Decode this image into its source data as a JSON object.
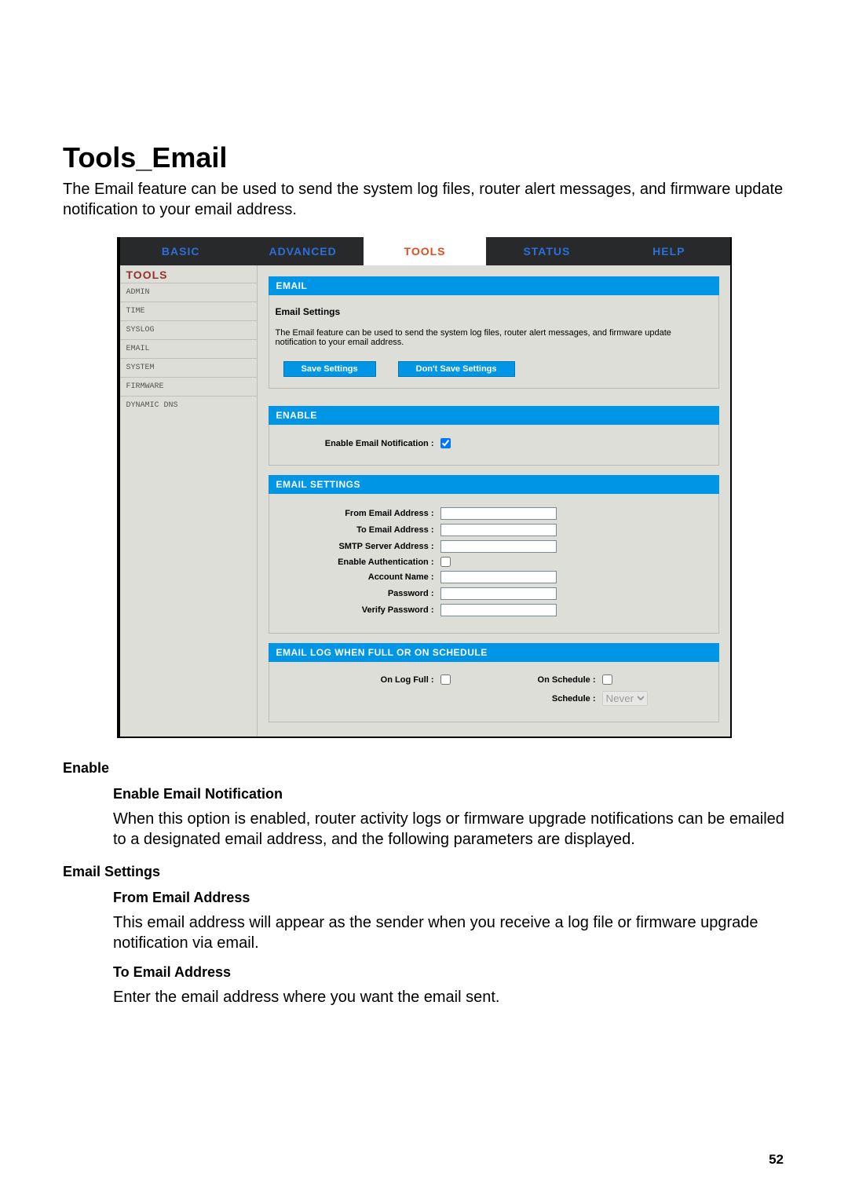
{
  "doc": {
    "title": "Tools_Email",
    "intro": "The Email feature can be used to send the system log files, router alert messages, and firmware update notification to your email address.",
    "page_number": "52",
    "sections": {
      "enable_h": "Enable",
      "enable_sub": "Enable Email Notification",
      "enable_p": "When this option is enabled, router activity logs or firmware upgrade notifications can be emailed to a designated email address, and the following parameters are displayed.",
      "emailset_h": "Email Settings",
      "from_sub": "From Email Address",
      "from_p": "This email address will appear as the sender when you receive a log file or firmware upgrade notification via email.",
      "to_sub": "To Email Address",
      "to_p": "Enter the email address where you want the email sent."
    }
  },
  "ui": {
    "tabs": [
      "BASIC",
      "ADVANCED",
      "TOOLS",
      "STATUS",
      "HELP"
    ],
    "active_tab": "TOOLS",
    "sidebar_header": "TOOLS",
    "sidebar": [
      "ADMIN",
      "TIME",
      "SYSLOG",
      "EMAIL",
      "SYSTEM",
      "FIRMWARE",
      "DYNAMIC DNS"
    ],
    "panel1_title": "EMAIL",
    "panel1_sub": "Email Settings",
    "panel1_desc": "The Email feature can be used to send the system log files, router alert messages, and firmware update notification to your email address.",
    "btn_save": "Save Settings",
    "btn_dont": "Don't Save Settings",
    "panel_enable": "ENABLE",
    "enable_label": "Enable Email Notification :",
    "enable_checked": true,
    "panel_settings": "EMAIL SETTINGS",
    "from_label": "From Email Address :",
    "to_label": "To Email Address :",
    "smtp_label": "SMTP Server Address :",
    "auth_label": "Enable Authentication :",
    "auth_checked": false,
    "acct_label": "Account Name :",
    "pwd_label": "Password :",
    "vpwd_label": "Verify Password :",
    "panel_log": "EMAIL LOG WHEN FULL OR ON SCHEDULE",
    "onlogfull_label": "On Log Full :",
    "onlogfull_checked": false,
    "onschedule_label": "On Schedule :",
    "onschedule_checked": false,
    "schedule_label": "Schedule :",
    "schedule_value": "Never"
  }
}
